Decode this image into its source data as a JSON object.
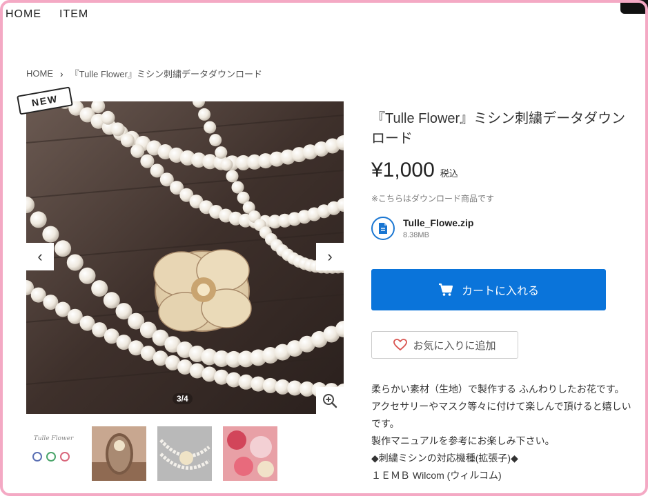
{
  "topnav": {
    "items": [
      "HOME",
      "ITEM"
    ]
  },
  "breadcrumb": {
    "home": "HOME",
    "current": "『Tulle Flower』ミシン刺繍データダウンロード"
  },
  "badge": {
    "label": "NEW"
  },
  "gallery": {
    "counter": "3/4",
    "thumbnail_caption": "Tulle Flower"
  },
  "product": {
    "title": "『Tulle Flower』ミシン刺繍データダウンロード",
    "price": "¥1,000",
    "tax_label": "税込",
    "download_note": "※こちらはダウンロード商品です",
    "file": {
      "name": "Tulle_Flowe.zip",
      "size": "8.38MB"
    }
  },
  "actions": {
    "cart_label": "カートに入れる",
    "favorite_label": "お気に入りに追加"
  },
  "description": [
    "柔らかい素材（生地）で製作する ふんわりしたお花です。",
    "アクセサリーやマスク等々に付けて楽しんで頂けると嬉しいです。",
    "製作マニュアルを参考にお楽しみ下さい。",
    "◆刺繍ミシンの対応機種(拡張子)◆",
    "１ＥＭＢ Wilcom (ウィルコム)"
  ],
  "colors": {
    "accent": "#0a74da",
    "frame": "#f4a9c4",
    "heart": "#d9534f",
    "file_icon": "#1976d2"
  },
  "icons": [
    "chevron-left-icon",
    "chevron-right-icon",
    "zoom-in-icon",
    "cart-icon",
    "heart-icon",
    "file-icon"
  ]
}
